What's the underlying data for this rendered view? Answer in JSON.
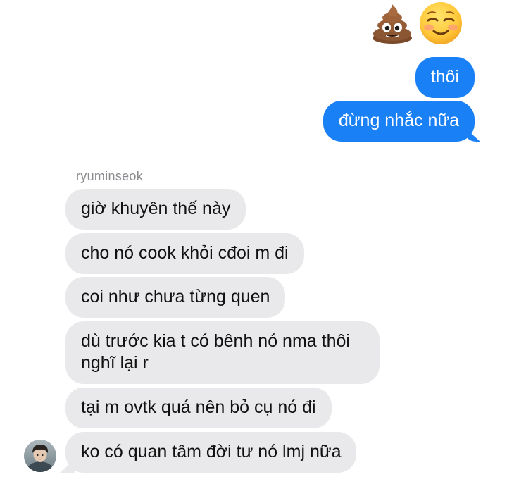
{
  "reactions": {
    "icons": [
      "pile-of-poo-emoji",
      "smiling-face-emoji"
    ]
  },
  "sent_messages": [
    {
      "text": "thôi"
    },
    {
      "text": "đừng nhắc nữa"
    }
  ],
  "sender": {
    "name": "ryuminseok",
    "avatar_icon": "user-avatar-photo"
  },
  "received_messages": [
    {
      "text": "giờ khuyên thế này"
    },
    {
      "text": "cho nó cook khỏi cđoi m đi"
    },
    {
      "text": "coi như chưa từng quen"
    },
    {
      "text": "dù trước kia t có bênh nó nma thôi nghĩ lại r"
    },
    {
      "text": "tại m ovtk quá nên bỏ cụ nó đi"
    },
    {
      "text": "ko có quan tâm đời tư nó lmj nữa"
    }
  ],
  "colors": {
    "sent_bubble": "#1a80f6",
    "received_bubble": "#e9e9eb",
    "sender_name": "#8b8b90"
  }
}
